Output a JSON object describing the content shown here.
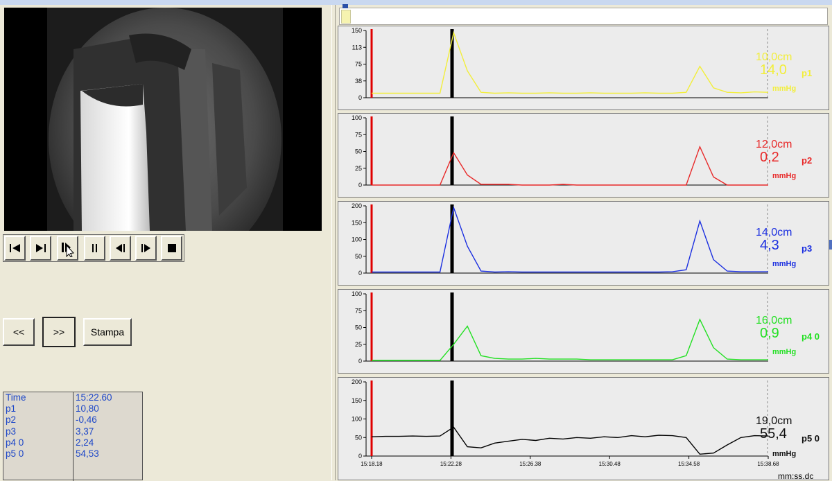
{
  "controls": {
    "first_icon": "first-frame-icon",
    "play_icon": "play-icon",
    "step_icon": "step-icon",
    "pause_icon": "pause-icon",
    "prev_icon": "previous-frame-icon",
    "next_icon": "next-frame-icon",
    "stop_icon": "stop-icon"
  },
  "nav": {
    "back_label": "<<",
    "forward_label": ">>",
    "print_label": "Stampa"
  },
  "values_table": {
    "labels": [
      "Time",
      "p1",
      "p2",
      "p3",
      "p4 0",
      "p5 0"
    ],
    "values": [
      "15:22.60",
      "10,80",
      "-0,46",
      "3,37",
      "2,24",
      "54,53"
    ]
  },
  "channels": [
    {
      "depth": "10,0cm",
      "value": "14,0",
      "name": "p1",
      "unit": "mmHg",
      "color": "#f2ee3a",
      "ticks": [
        "150",
        "113",
        "75",
        "38",
        "0"
      ]
    },
    {
      "depth": "12,0cm",
      "value": "0,2",
      "name": "p2",
      "unit": "mmHg",
      "color": "#e82828",
      "ticks": [
        "100",
        "75",
        "50",
        "25",
        "0"
      ]
    },
    {
      "depth": "14,0cm",
      "value": "4,3",
      "name": "p3",
      "unit": "mmHg",
      "color": "#1a2ee0",
      "ticks": [
        "200",
        "150",
        "100",
        "50",
        "0"
      ]
    },
    {
      "depth": "16,0cm",
      "value": "0,9",
      "name": "p4 0",
      "unit": "mmHg",
      "color": "#22e022",
      "ticks": [
        "100",
        "75",
        "50",
        "25",
        "0"
      ]
    },
    {
      "depth": "19,0cm",
      "value": "55,4",
      "name": "p5 0",
      "unit": "mmHg",
      "color": "#000000",
      "ticks": [
        "200",
        "150",
        "100",
        "50",
        "0"
      ]
    }
  ],
  "time_axis": {
    "ticks": [
      "15:18.18",
      "15:22.28",
      "15:26.38",
      "15:30.48",
      "15:34.58",
      "15:38.68"
    ],
    "format": "mm:ss.dc"
  },
  "chart_data": [
    {
      "type": "line",
      "title": "",
      "series": [
        {
          "name": "p1",
          "values": [
            10,
            10,
            10,
            10,
            10,
            10,
            145,
            60,
            12,
            10,
            11,
            10,
            10,
            11,
            10,
            10,
            11,
            10,
            10,
            10,
            11,
            10,
            10,
            12,
            70,
            22,
            12,
            11,
            13,
            12
          ]
        }
      ],
      "ylim": [
        0,
        150
      ],
      "xlabel": "",
      "ylabel": ""
    },
    {
      "type": "line",
      "title": "",
      "series": [
        {
          "name": "p2",
          "values": [
            0,
            0,
            0,
            0,
            0,
            0,
            48,
            15,
            1,
            1,
            1,
            0,
            0,
            0,
            1,
            0,
            0,
            0,
            0,
            0,
            0,
            0,
            0,
            0,
            57,
            12,
            0,
            0,
            0,
            0
          ]
        }
      ],
      "ylim": [
        0,
        100
      ],
      "xlabel": "",
      "ylabel": ""
    },
    {
      "type": "line",
      "title": "",
      "series": [
        {
          "name": "p3",
          "values": [
            3,
            3,
            3,
            3,
            3,
            3,
            195,
            80,
            6,
            3,
            4,
            3,
            3,
            3,
            3,
            3,
            3,
            3,
            3,
            3,
            3,
            3,
            4,
            10,
            155,
            40,
            6,
            4,
            4,
            4
          ]
        }
      ],
      "ylim": [
        0,
        200
      ],
      "xlabel": "",
      "ylabel": ""
    },
    {
      "type": "line",
      "title": "",
      "series": [
        {
          "name": "p4 0",
          "values": [
            1,
            1,
            1,
            1,
            1,
            1,
            25,
            52,
            8,
            4,
            3,
            3,
            4,
            3,
            3,
            3,
            2,
            2,
            2,
            2,
            2,
            2,
            2,
            8,
            62,
            20,
            3,
            2,
            2,
            2
          ]
        }
      ],
      "ylim": [
        0,
        100
      ],
      "xlabel": "",
      "ylabel": ""
    },
    {
      "type": "line",
      "title": "",
      "series": [
        {
          "name": "p5 0",
          "values": [
            52,
            53,
            53,
            54,
            53,
            54,
            78,
            25,
            22,
            35,
            40,
            45,
            42,
            48,
            46,
            50,
            48,
            52,
            50,
            55,
            52,
            56,
            55,
            50,
            5,
            8,
            30,
            50,
            55,
            54
          ]
        }
      ],
      "ylim": [
        0,
        200
      ],
      "xlabel": "",
      "ylabel": ""
    }
  ]
}
